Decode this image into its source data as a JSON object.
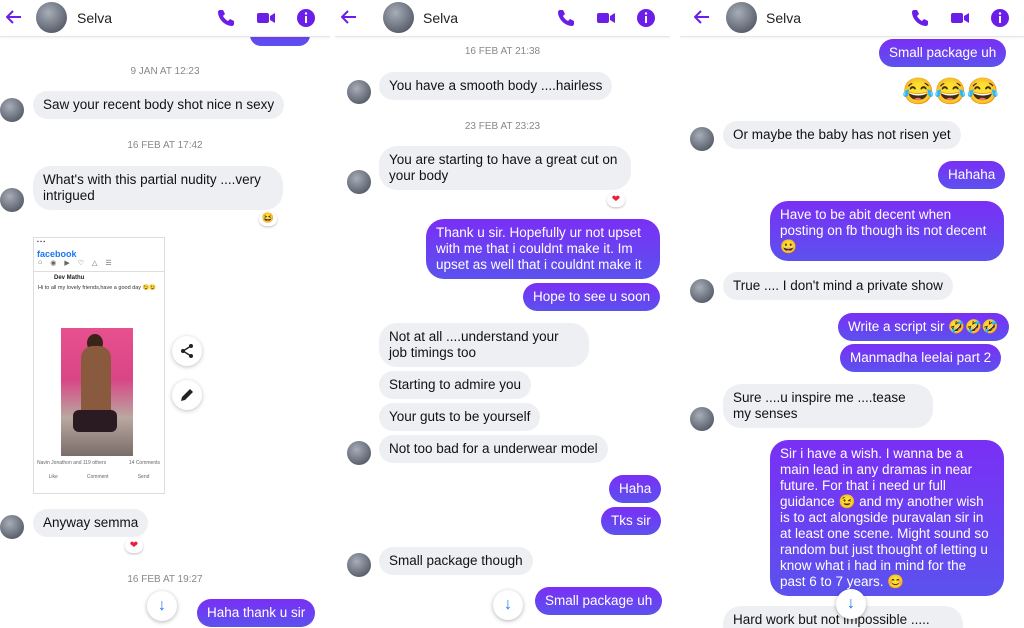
{
  "contact": {
    "name": "Selva"
  },
  "colors": {
    "accent": "#6a1ee8",
    "bubble_out": "#6b33f0",
    "bubble_in": "#eeeff2"
  },
  "icons": {
    "back": "arrow-left-icon",
    "call": "phone-icon",
    "video": "video-icon",
    "info": "info-icon"
  },
  "panel1": {
    "ts1": "9 JAN AT 12:23",
    "m1": "Saw your recent body shot nice n sexy",
    "ts2": "16 FEB AT 17:42",
    "m2": "What's with this partial nudity ....very intrigued",
    "r2": "😆",
    "shot": {
      "app": "facebook",
      "poster": "Dev Mathu",
      "post_text": "Hi to all my lovely friends,have a good day 😉😉",
      "likes": "Navin Jonathon and 119 others",
      "comments": "14 Comments",
      "like": "Like",
      "comment": "Comment",
      "send": "Send"
    },
    "m3": "Anyway semma",
    "r3": "❤",
    "ts3": "16 FEB AT 19:27",
    "m4": "Haha thank u sir"
  },
  "panel2": {
    "ts1": "16 FEB AT 21:38",
    "m1": "You have a smooth body ....hairless",
    "ts2": "23 FEB AT 23:23",
    "m2": "You are starting to have a great cut on your body",
    "r2": "❤",
    "m3": "Thank u sir. Hopefully ur not upset with me that i couldnt make it. Im upset as well that i couldnt make it",
    "m4": "Hope to see u soon",
    "m5": "Not at all ....understand your job timings too",
    "m6": "Starting to admire you",
    "m7": "Your guts to be yourself",
    "m8": "Not too bad for a underwear model",
    "m9": "Haha",
    "m10": "Tks sir",
    "m11": "Small package though",
    "m12": "Small package uh"
  },
  "panel3": {
    "m1": "Small package uh",
    "e1": "😂😂😂",
    "m2": "Or maybe the baby has not risen yet",
    "m3": "Hahaha",
    "m4": "Have to be abit decent when posting on fb though its not decent 😀",
    "m5": "True .... I don't mind a private show",
    "m6": "Write a script sir 🤣🤣🤣",
    "m7": "Manmadha leelai part 2",
    "m8": "Sure ....u inspire me ....tease my senses",
    "m9": "Sir i have a wish. I wanna be a main lead in any dramas in near future. For that i need ur full guidance 😉 and my another wish is to act alongside puravalan sir in at least one scene. Might sound so random but just thought of letting u know what i had in mind for the past 6 to 7 years. 😊",
    "m10": "Hard work but not impossible ..... You"
  }
}
